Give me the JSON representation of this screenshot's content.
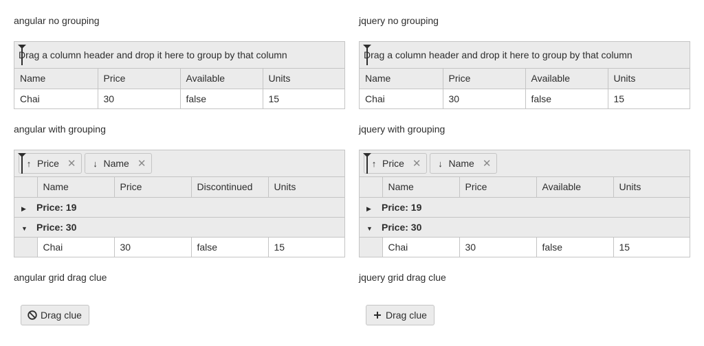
{
  "left": {
    "no_grouping": {
      "title": "angular no grouping",
      "hint": "Drag a column header and drop it here to group by that column",
      "columns": [
        "Name",
        "Price",
        "Available",
        "Units"
      ],
      "row": [
        "Chai",
        "30",
        "false",
        "15"
      ]
    },
    "with_grouping": {
      "title": "angular with grouping",
      "chips": [
        {
          "label": "Price",
          "dir": "asc"
        },
        {
          "label": "Name",
          "dir": "desc"
        }
      ],
      "columns": [
        "Name",
        "Price",
        "Discontinued",
        "Units"
      ],
      "groups": [
        {
          "label": "Price: 19",
          "expanded": false
        },
        {
          "label": "Price: 30",
          "expanded": true
        }
      ],
      "row": [
        "Chai",
        "30",
        "false",
        "15"
      ]
    },
    "drag_clue": {
      "title": "angular grid drag clue",
      "label": "Drag clue",
      "icon": "cancel-icon"
    }
  },
  "right": {
    "no_grouping": {
      "title": "jquery no grouping",
      "hint": "Drag a column header and drop it here to group by that column",
      "columns": [
        "Name",
        "Price",
        "Available",
        "Units"
      ],
      "row": [
        "Chai",
        "30",
        "false",
        "15"
      ]
    },
    "with_grouping": {
      "title": "jquery with grouping",
      "chips": [
        {
          "label": "Price",
          "dir": "asc"
        },
        {
          "label": "Name",
          "dir": "desc"
        }
      ],
      "columns": [
        "Name",
        "Price",
        "Available",
        "Units"
      ],
      "groups": [
        {
          "label": "Price: 19",
          "expanded": false
        },
        {
          "label": "Price: 30",
          "expanded": true
        }
      ],
      "row": [
        "Chai",
        "30",
        "false",
        "15"
      ]
    },
    "drag_clue": {
      "title": "jquery grid drag clue",
      "label": "Drag clue",
      "icon": "plus-icon"
    }
  },
  "icons": {
    "sort_asc": "↑",
    "sort_desc": "↓",
    "close": "✕",
    "collapsed": "▶",
    "expanded": "▼"
  }
}
